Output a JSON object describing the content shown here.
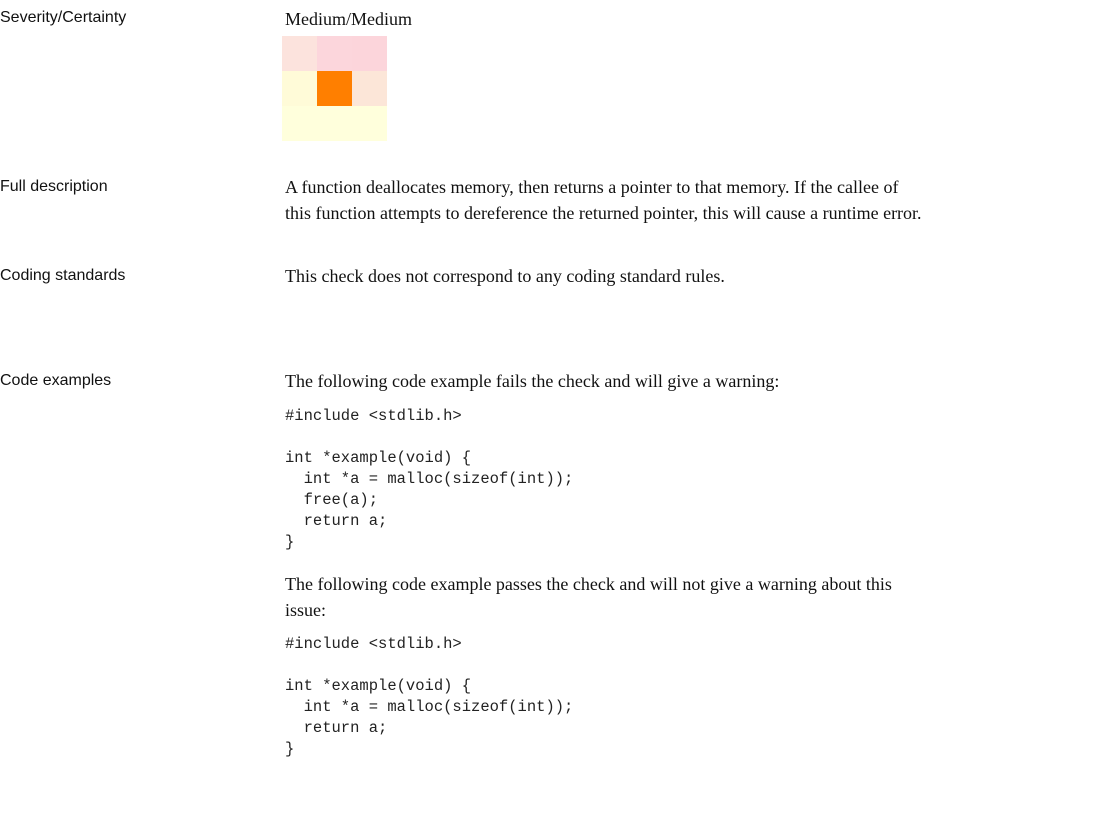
{
  "severity": {
    "label": "Severity/Certainty",
    "value": "Medium/Medium",
    "matrix": {
      "rows": [
        [
          "#fce3dd",
          "#fcd6dc",
          "#fcd5db"
        ],
        [
          "#fffbd8",
          "#ff7f00",
          "#fce6d8"
        ],
        [
          "#ffffdc",
          "#ffffdc",
          "#ffffdc"
        ]
      ],
      "highlighted": "Medium/Medium"
    }
  },
  "description": {
    "label": "Full description",
    "lines": [
      "A function deallocates memory, then returns a pointer to that memory. If the callee of",
      "this function attempts to dereference the returned pointer, this will cause a runtime error."
    ]
  },
  "coding_standards": {
    "label": "Coding standards",
    "text": "This check does not correspond to any coding standard rules."
  },
  "code_examples": {
    "label": "Code examples",
    "fail_intro": "The following code example fails the check and will give a warning:",
    "fail_code": [
      "#include <stdlib.h>",
      "",
      "int *example(void) {",
      "  int *a = malloc(sizeof(int));",
      "  free(a);",
      "  return a;",
      "}"
    ],
    "pass_intro": [
      "The following code example passes the check and will not give a warning about this",
      "issue:"
    ],
    "pass_code": [
      "#include <stdlib.h>",
      "",
      "int *example(void) {",
      "  int *a = malloc(sizeof(int));",
      "  return a;",
      "}"
    ]
  }
}
